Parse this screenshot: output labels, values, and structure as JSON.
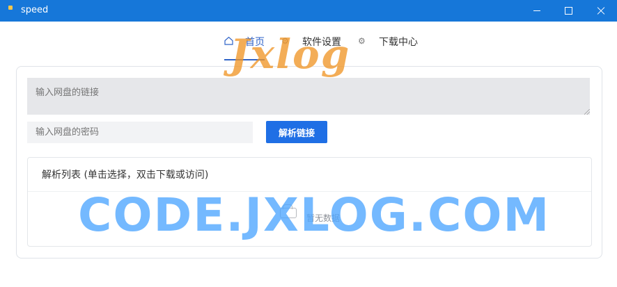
{
  "window": {
    "title": "speed"
  },
  "tabs": [
    {
      "label": "首页",
      "icon": "home-icon"
    },
    {
      "label": "软件设置",
      "icon": "gear-icon"
    },
    {
      "label": "下载中心",
      "icon": "gear-icon"
    }
  ],
  "form": {
    "link_placeholder": "输入网盘的链接",
    "password_placeholder": "输入网盘的密码",
    "parse_button": "解析链接"
  },
  "result": {
    "header": "解析列表 (单击选择，双击下载或访问)",
    "empty_text": "暂无数据"
  },
  "watermark": {
    "logo": "Jxlog",
    "site": "CODE.JXLOG.COM"
  },
  "colors": {
    "title_bar": "#1677d9",
    "accent": "#2f63c8",
    "button": "#1f6fe5"
  }
}
